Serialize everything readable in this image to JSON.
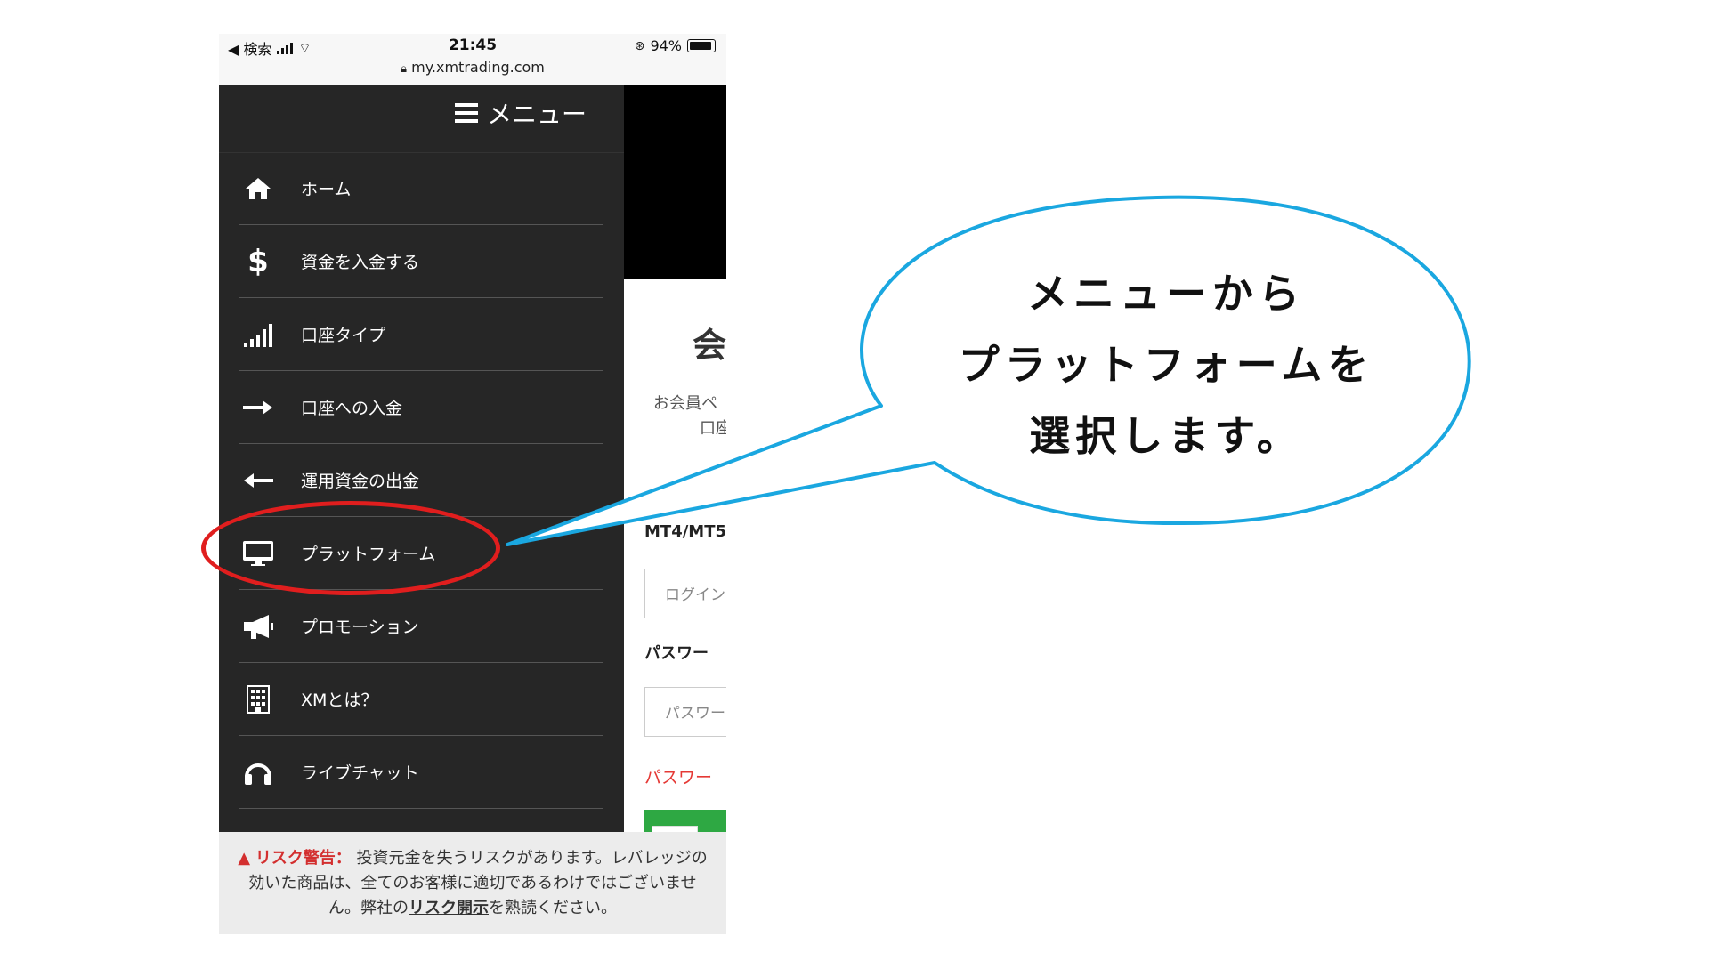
{
  "statusbar": {
    "back_label": "◀ 検索",
    "time": "21:45",
    "battery": "94%",
    "url": "my.xmtrading.com"
  },
  "menu": {
    "title": "メニュー",
    "items": [
      {
        "label": "ホーム",
        "icon": "home-icon"
      },
      {
        "label": "資金を入金する",
        "icon": "dollar-icon"
      },
      {
        "label": "口座タイプ",
        "icon": "signal-bars-icon"
      },
      {
        "label": "口座への入金",
        "icon": "arrow-right-icon"
      },
      {
        "label": "運用資金の出金",
        "icon": "arrow-left-icon"
      },
      {
        "label": "プラットフォーム",
        "icon": "monitor-icon"
      },
      {
        "label": "プロモーション",
        "icon": "megaphone-icon"
      },
      {
        "label": "XMとは？",
        "icon": "building-icon"
      },
      {
        "label": "ライブチャット",
        "icon": "headset-icon"
      }
    ]
  },
  "page": {
    "title": "会",
    "subtitle_line1": "お会員ペ",
    "subtitle_line2": "口座",
    "login_label": "MT4/MT5",
    "login_placeholder": "ログイン",
    "password_label": "パスワー",
    "password_placeholder": "パスワー",
    "forgot_link": "パスワー"
  },
  "risk": {
    "warning_label": "リスク警告：",
    "text_before": "投資元金を失うリスクがあります。レバレッジの効いた商品は、全てのお客様に適切であるわけではございません。弊社の",
    "link": "リスク開示",
    "text_after": "を熟読ください。"
  },
  "annotation": {
    "line1": "メニューから",
    "line2": "プラットフォームを",
    "line3": "選択します。"
  }
}
